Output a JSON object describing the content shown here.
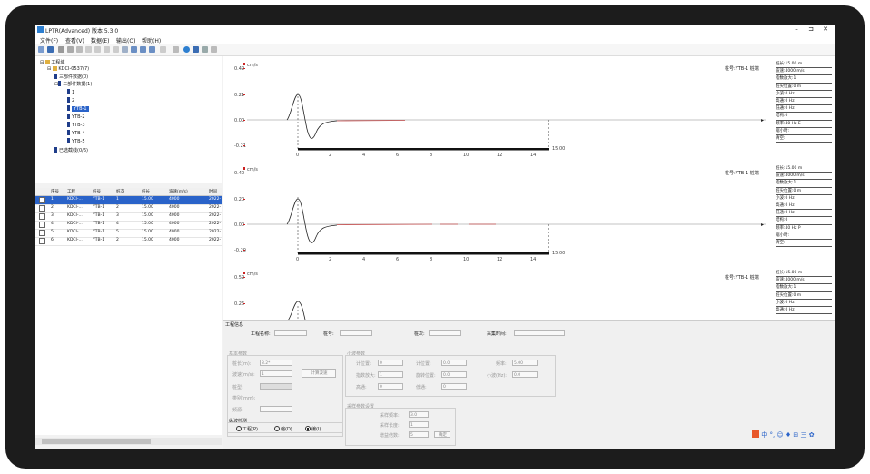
{
  "window": {
    "title": "LPTR(Advanced) 版本 5.3.0",
    "min": "–",
    "max": "⊐",
    "close": "✕"
  },
  "menu": [
    "文件(F)",
    "查看(V)",
    "数据(E)",
    "输出(O)",
    "帮助(H)"
  ],
  "colors": {
    "accent": "#2a63c9",
    "marker": "#cc2222",
    "trace": "#222222",
    "tree_icon": "#1f3d8a"
  },
  "tree": {
    "root": "工程域",
    "project": "KDCI-0537(7)",
    "nodes": [
      "三部件数据(0)",
      "三部件数据(1)",
      "1",
      "2",
      "YTB-1",
      "YTB-2",
      "YTB-3",
      "YTB-4",
      "YTB-5",
      "已选截线(0/6)"
    ]
  },
  "table": {
    "headers": [
      "序号",
      "工程",
      "桩号",
      "桩次",
      "桩长",
      "波速(m/s)",
      "时间"
    ],
    "rows": [
      {
        "no": "1",
        "proj": "KDCI-...",
        "pile": "YTB-1",
        "times": "1",
        "len": "15.00",
        "speed": "4000",
        "time": "2022-"
      },
      {
        "no": "2",
        "proj": "KDCI-...",
        "pile": "YTB-1",
        "times": "2",
        "len": "15.00",
        "speed": "4000",
        "time": "2022-"
      },
      {
        "no": "3",
        "proj": "KDCI-...",
        "pile": "YTB-1",
        "times": "3",
        "len": "15.00",
        "speed": "4000",
        "time": "2022-"
      },
      {
        "no": "4",
        "proj": "KDCI-...",
        "pile": "YTB-1",
        "times": "4",
        "len": "15.00",
        "speed": "4000",
        "time": "2022-"
      },
      {
        "no": "5",
        "proj": "KDCI-...",
        "pile": "YTB-1",
        "times": "5",
        "len": "15.00",
        "speed": "4000",
        "time": "2022-"
      },
      {
        "no": "6",
        "proj": "KDCI-...",
        "pile": "YTB-1",
        "times": "2",
        "len": "15.00",
        "speed": "4000",
        "time": "2022-"
      }
    ]
  },
  "plots": [
    {
      "unit": "cm/s",
      "yticks": [
        "0.42",
        "0.21",
        "0.00",
        "-0.21"
      ],
      "xticks": [
        "0",
        "2",
        "4",
        "6",
        "8",
        "10",
        "12",
        "14"
      ],
      "end_label": "15.00",
      "track": "桩号:YTB-1 桩端",
      "info": [
        "桩长:15.00 m",
        "波速:4000 m/s",
        "指数放大:1",
        "桩尖位置:0 m",
        "小波:0 Hz",
        "高通:0 Hz",
        "低通:0 Hz",
        "结构:0",
        "频率:40 Hz E",
        "缩小时:",
        "清空:"
      ]
    },
    {
      "unit": "cm/s",
      "yticks": [
        "0.40",
        "0.20",
        "0.00",
        "-0.20"
      ],
      "xticks": [
        "0",
        "2",
        "4",
        "6",
        "8",
        "10",
        "12",
        "14"
      ],
      "end_label": "15.00",
      "track": "桩号:YTB-1 桩端",
      "info": [
        "桩长:15.00 m",
        "波速:4000 m/s",
        "指数放大:1",
        "桩尖位置:0 m",
        "小波:0 Hz",
        "高通:0 Hz",
        "低通:0 Hz",
        "结构:0",
        "频率:40 Hz P",
        "缩小时:",
        "清空:"
      ]
    },
    {
      "unit": "cm/s",
      "yticks": [
        "0.52",
        "0.26"
      ],
      "xticks": [],
      "end_label": "",
      "track": "桩号:YTB-1 桩端",
      "info": [
        "桩长:15.00 m",
        "波速:4000 m/s",
        "指数放大:1",
        "桩尖位置:0 m",
        "小波:0 Hz",
        "高通:0 Hz"
      ]
    }
  ],
  "panel": {
    "section": "工程信息",
    "proj_label": "工程名称:",
    "pile_label": "桩号:",
    "times_label": "桩次:",
    "time_label": "采集时间:",
    "basic": "基本参数",
    "len_label": "桩长(m):",
    "len_val": "8.2*",
    "speed_label": "波速(m/s):",
    "speed_val": "1",
    "calc_btn": "计算波速",
    "grade_label": "桩型:",
    "mode_label": "类别(mm):",
    "source_label": "频源:",
    "filter": "小波参数",
    "f1": "计位置:",
    "f2": "计位置:",
    "f3": "指数放大:",
    "f4": "旋转位置:",
    "f5": "高通:",
    "f6": "低通:",
    "f_val1": "0",
    "f_val2": "0.0",
    "f_val3": "1",
    "f_val4": "0.0",
    "f_val5": "0",
    "f_val6": "0",
    "freq_label": "频率:",
    "freq_val": "5.00",
    "cut_label": "小波(Hz):",
    "cut_val": "0.0",
    "mode_group": "纵波检测",
    "radio1": "工程(P)",
    "radio2": "缩(D)",
    "radio3": "编(I)",
    "sampling": "采样参数设置",
    "s1": "采样频率:",
    "s1v": "3.0",
    "s2": "采样长度:",
    "s2v": "1",
    "s3": "增益倍数:",
    "s3v": "5",
    "apply": "确定"
  },
  "ime": "中 °, ☺ ♦ ⊞ 三 ✿"
}
